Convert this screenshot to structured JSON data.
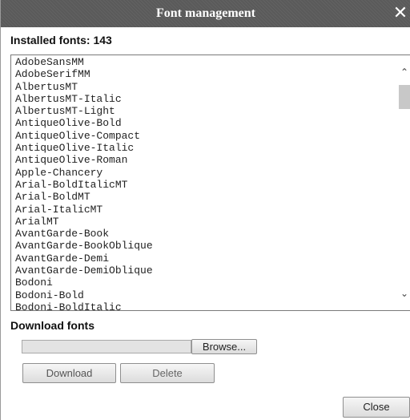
{
  "dialog": {
    "title": "Font management",
    "close_icon": "close-x-icon"
  },
  "installed": {
    "label": "Installed fonts: 143"
  },
  "fonts": [
    "AdobeSansMM",
    "AdobeSerifMM",
    "AlbertusMT",
    "AlbertusMT-Italic",
    "AlbertusMT-Light",
    "AntiqueOlive-Bold",
    "AntiqueOlive-Compact",
    "AntiqueOlive-Italic",
    "AntiqueOlive-Roman",
    "Apple-Chancery",
    "Arial-BoldItalicMT",
    "Arial-BoldMT",
    "Arial-ItalicMT",
    "ArialMT",
    "AvantGarde-Book",
    "AvantGarde-BookOblique",
    "AvantGarde-Demi",
    "AvantGarde-DemiOblique",
    "Bodoni",
    "Bodoni-Bold",
    "Bodoni-BoldItalic"
  ],
  "download_section": {
    "heading": "Download fonts",
    "file_value": "",
    "browse_label": "Browse...",
    "download_label": "Download",
    "delete_label": "Delete"
  },
  "footer": {
    "close_label": "Close"
  },
  "colors": {
    "titlebar": "#5a5a5a",
    "button_face": "#e6e6e6"
  }
}
